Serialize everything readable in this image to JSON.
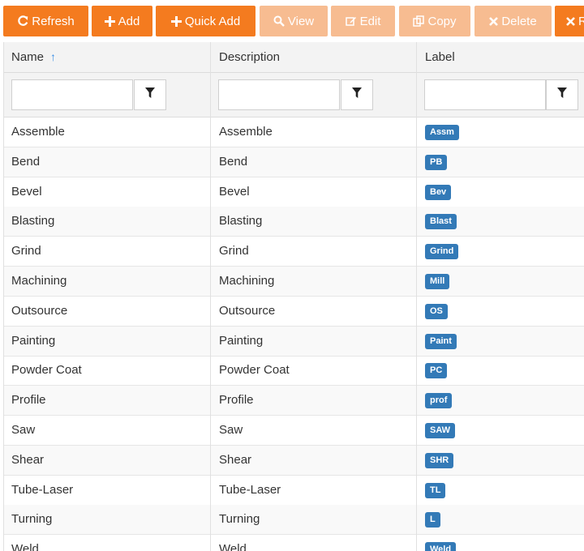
{
  "toolbar": {
    "buttons": [
      {
        "label": "Refresh",
        "icon": "refresh-icon",
        "state": "active"
      },
      {
        "label": "Add",
        "icon": "plus-icon",
        "state": "active"
      },
      {
        "label": "Quick Add",
        "icon": "plus-icon",
        "state": "active"
      },
      {
        "label": "View",
        "icon": "search-icon",
        "state": "disabled"
      },
      {
        "label": "Edit",
        "icon": "edit-icon",
        "state": "disabled"
      },
      {
        "label": "Copy",
        "icon": "copy-icon",
        "state": "disabled"
      },
      {
        "label": "Delete",
        "icon": "close-icon",
        "state": "disabled"
      },
      {
        "label": "R",
        "icon": "close-icon",
        "state": "active"
      }
    ]
  },
  "grid": {
    "columns": [
      {
        "label": "Name",
        "sort": "ascending",
        "filter_value": "",
        "filter_placeholder": ""
      },
      {
        "label": "Description",
        "filter_value": "",
        "filter_placeholder": ""
      },
      {
        "label": "Label",
        "filter_value": "",
        "filter_placeholder": ""
      }
    ],
    "rows": [
      {
        "name": "Assemble",
        "description": "Assemble",
        "label": "Assm"
      },
      {
        "name": "Bend",
        "description": "Bend",
        "label": "PB"
      },
      {
        "name": "Bevel",
        "description": "Bevel",
        "label": "Bev"
      },
      {
        "name": "Blasting",
        "description": "Blasting",
        "label": "Blast"
      },
      {
        "name": "Grind",
        "description": "Grind",
        "label": "Grind"
      },
      {
        "name": "Machining",
        "description": "Machining",
        "label": "Mill"
      },
      {
        "name": "Outsource",
        "description": "Outsource",
        "label": "OS"
      },
      {
        "name": "Painting",
        "description": "Painting",
        "label": "Paint"
      },
      {
        "name": "Powder Coat",
        "description": "Powder Coat",
        "label": "PC"
      },
      {
        "name": "Profile",
        "description": "Profile",
        "label": "prof"
      },
      {
        "name": "Saw",
        "description": "Saw",
        "label": "SAW"
      },
      {
        "name": "Shear",
        "description": "Shear",
        "label": "SHR"
      },
      {
        "name": "Tube-Laser",
        "description": "Tube-Laser",
        "label": "TL"
      },
      {
        "name": "Turning",
        "description": "Turning",
        "label": "L"
      },
      {
        "name": "Weld",
        "description": "Weld",
        "label": "Weld"
      }
    ]
  },
  "colors": {
    "button_active": "#f47b1f",
    "button_disabled": "#f7bc91",
    "badge": "#337ab7",
    "sort_arrow": "#3a8ee6"
  }
}
